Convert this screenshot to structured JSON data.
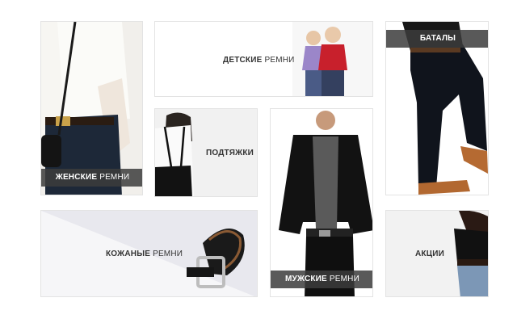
{
  "categories": {
    "womens": {
      "bold": "ЖЕНСКИЕ",
      "rest": " РЕМНИ"
    },
    "kids": {
      "bold": "ДЕТСКИЕ",
      "rest": " РЕМНИ"
    },
    "suspenders": {
      "bold": "ПОДТЯЖКИ",
      "rest": ""
    },
    "big_sizes": {
      "bold": "БАТАЛЫ",
      "rest": ""
    },
    "leather": {
      "bold": "КОЖАНЫЕ",
      "rest": " РЕМНИ"
    },
    "mens": {
      "bold": "МУЖСКИЕ",
      "rest": " РЕМНИ"
    },
    "sale": {
      "bold": "АКЦИИ",
      "rest": ""
    }
  }
}
